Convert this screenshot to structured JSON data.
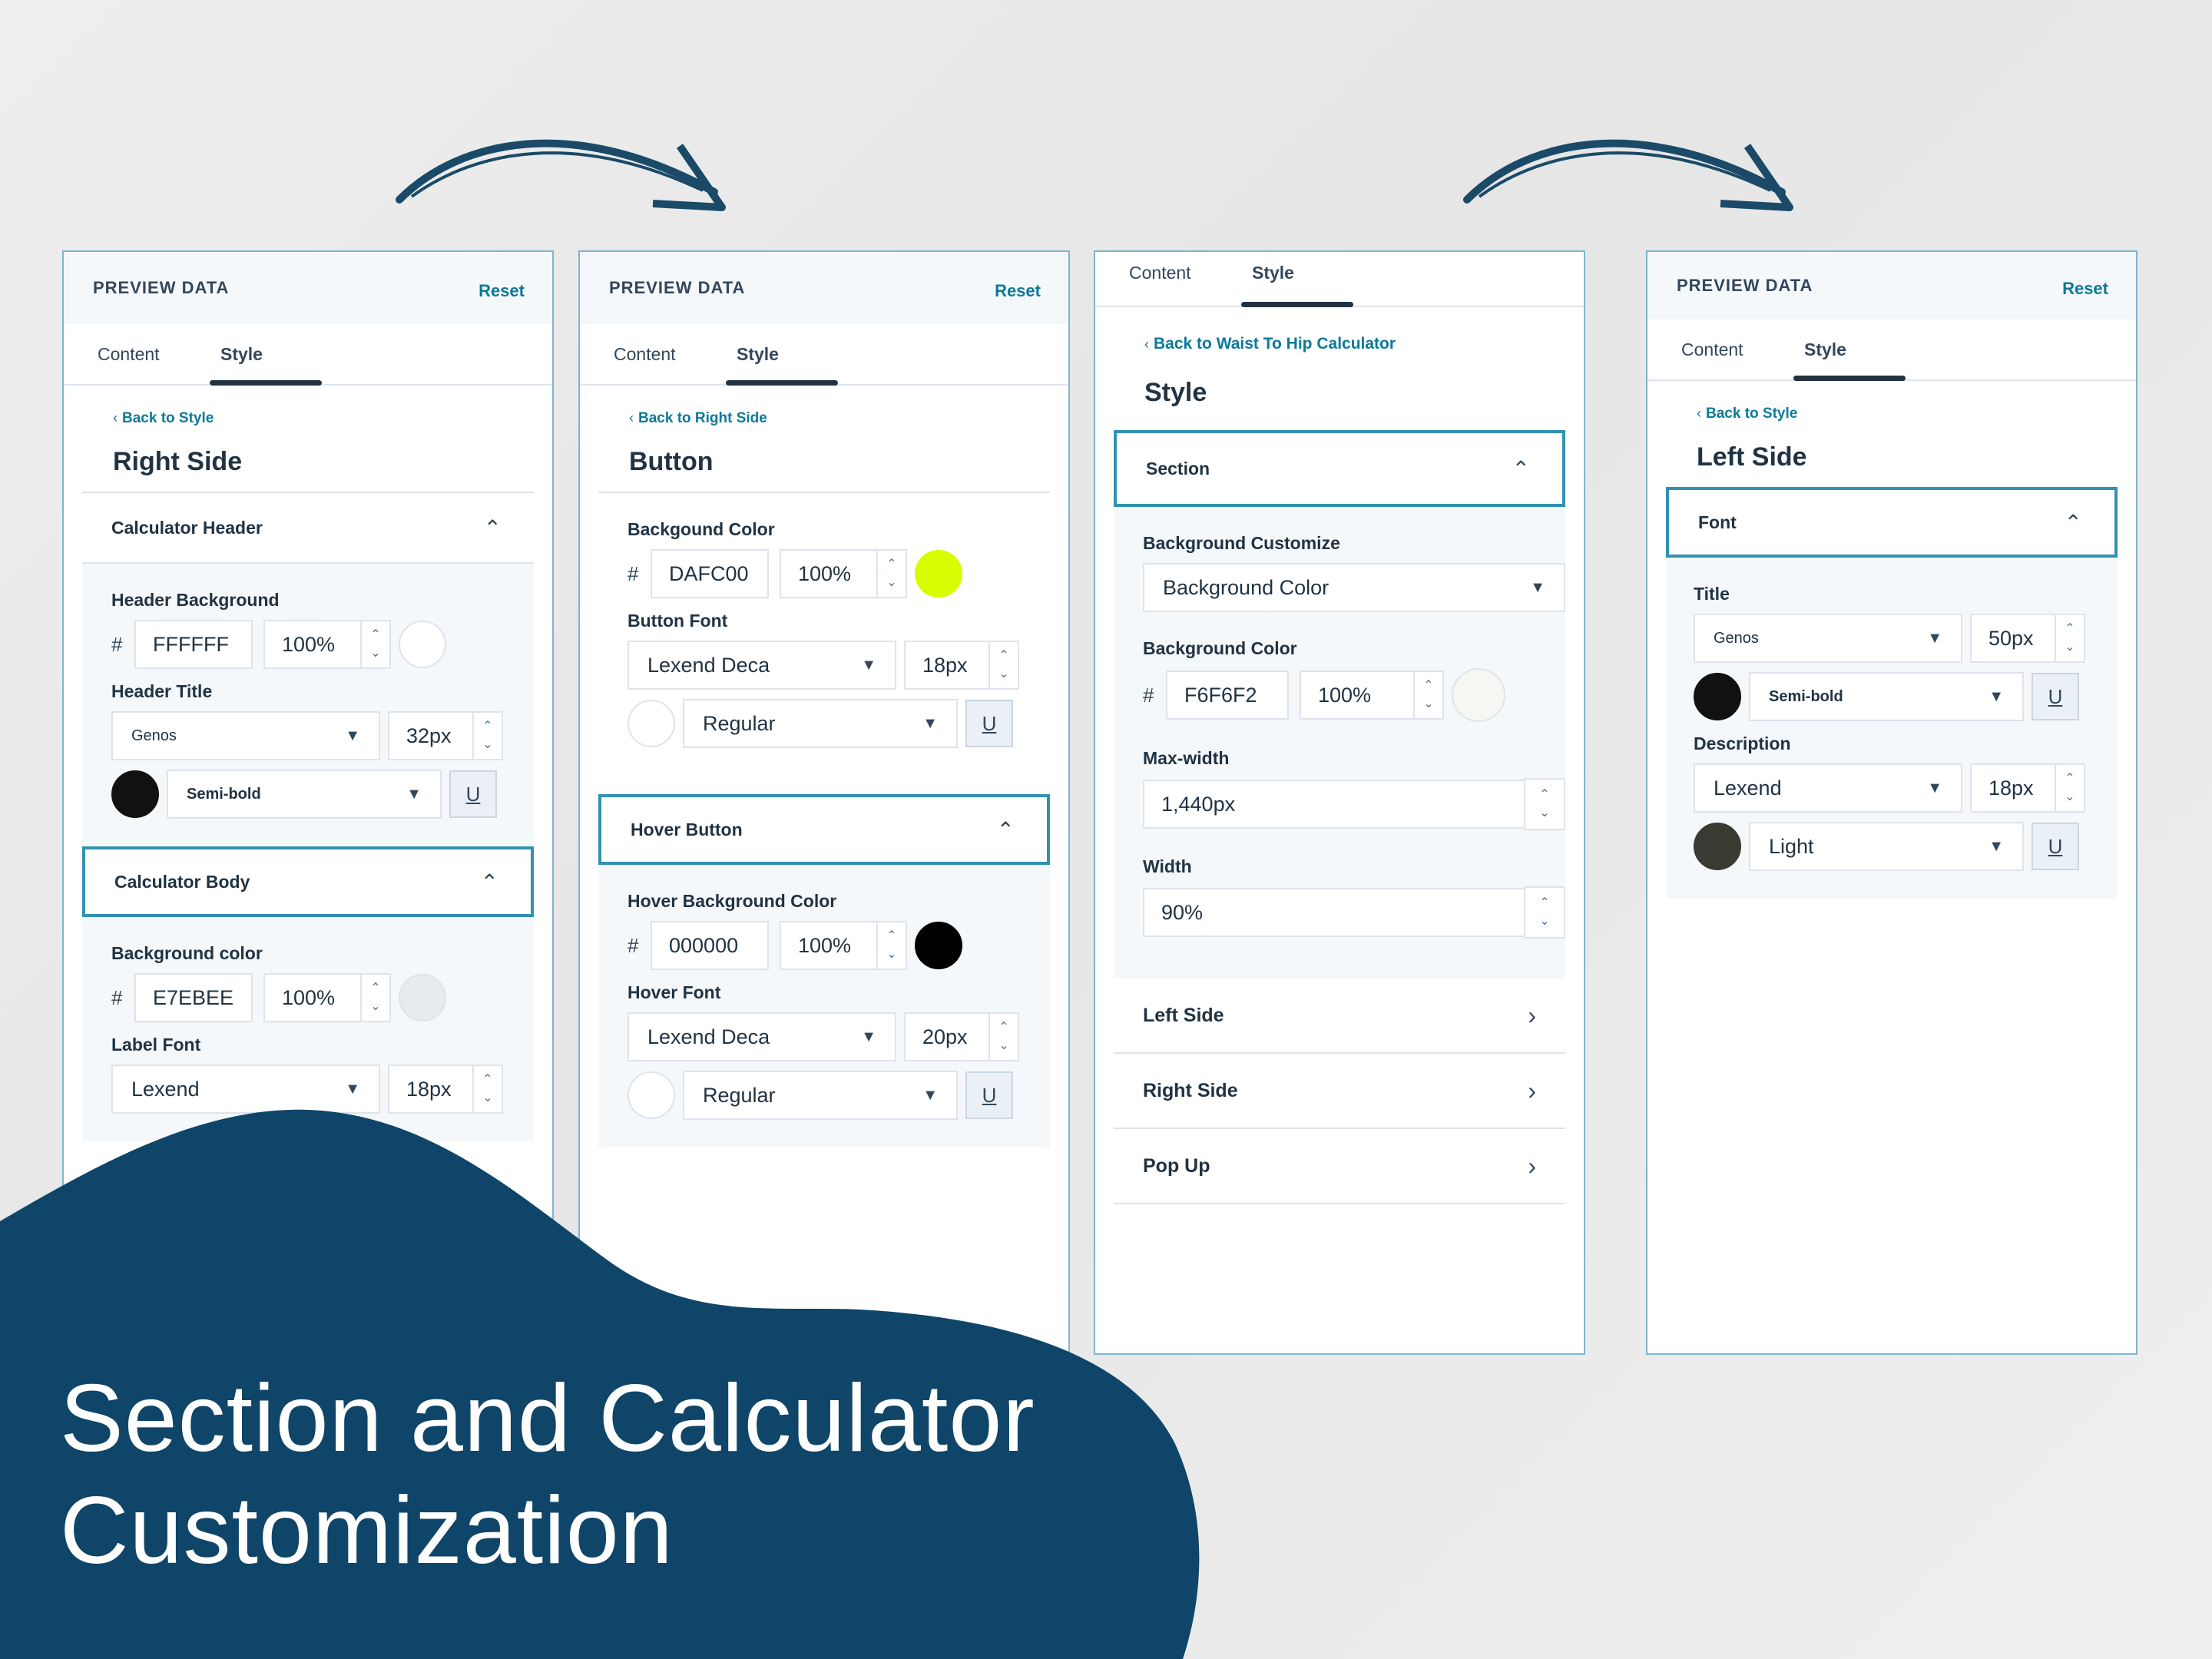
{
  "colors": {
    "accent": "#0b7a99",
    "navy": "#0e4568",
    "border": "#7fb5cc"
  },
  "headline": {
    "line1": "Section and Calculator",
    "line2": "Customization"
  },
  "panel1": {
    "header": "PREVIEW DATA",
    "reset": "Reset",
    "tabs": [
      "Content",
      "Style"
    ],
    "back": "Back to Style",
    "title": "Right Side",
    "sections": {
      "calc_header": "Calculator Header",
      "header_bg_label": "Header Background",
      "header_bg_hex": "FFFFFF",
      "header_bg_pct": "100%",
      "header_title_label": "Header Title",
      "header_title_font": "Genos",
      "header_title_size": "32px",
      "header_title_weight": "Semi-bold",
      "calc_body": "Calculator Body",
      "bg_color_label": "Background color",
      "bg_hex": "E7EBEE",
      "bg_pct": "100%",
      "label_font_label": "Label Font",
      "label_font": "Lexend",
      "label_size": "18px",
      "u": "U"
    }
  },
  "panel2": {
    "header": "PREVIEW DATA",
    "reset": "Reset",
    "tabs": [
      "Content",
      "Style"
    ],
    "back": "Back to Right Side",
    "title": "Button",
    "bg_label": "Backgound Color",
    "bg_hex": "DAFC00",
    "bg_pct": "100%",
    "font_label": "Button Font",
    "font": "Lexend Deca",
    "size": "18px",
    "weight": "Regular",
    "hover_section": "Hover Button",
    "hover_bg_label": "Hover Background Color",
    "hover_hex": "000000",
    "hover_pct": "100%",
    "hover_font_label": "Hover Font",
    "hover_font": "Lexend Deca",
    "hover_size": "20px",
    "hover_weight": "Regular",
    "u": "U",
    "swatch_bg": "#DAFC00",
    "swatch_hover": "#000000"
  },
  "panel3": {
    "tabs": [
      "Content",
      "Style"
    ],
    "back": "Back to Waist To Hip Calculator",
    "title": "Style",
    "section": "Section",
    "bg_custom_label": "Background Customize",
    "bg_custom_value": "Background Color",
    "bg_color_label": "Background Color",
    "bg_hex": "F6F6F2",
    "bg_pct": "100%",
    "maxw_label": "Max-width",
    "maxw_value": "1,440px",
    "width_label": "Width",
    "width_value": "90%",
    "nav": [
      "Left Side",
      "Right Side",
      "Pop Up"
    ]
  },
  "panel4": {
    "header": "PREVIEW DATA",
    "reset": "Reset",
    "tabs": [
      "Content",
      "Style"
    ],
    "back": "Back to Style",
    "title": "Left Side",
    "font_section": "Font",
    "title_label": "Title",
    "title_font": "Genos",
    "title_size": "50px",
    "title_weight": "Semi-bold",
    "desc_label": "Description",
    "desc_font": "Lexend",
    "desc_size": "18px",
    "desc_weight": "Light",
    "u": "U"
  }
}
